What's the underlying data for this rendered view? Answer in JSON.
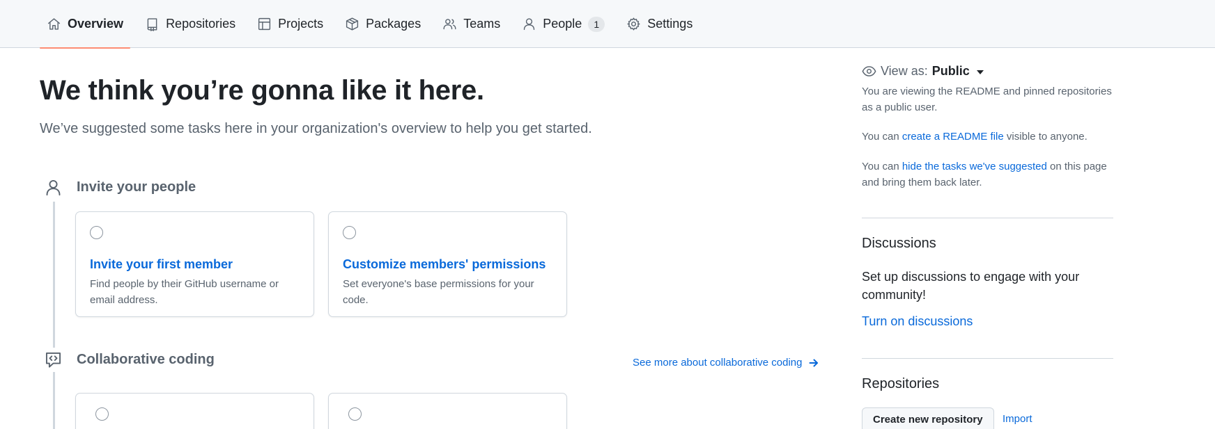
{
  "nav": {
    "tabs": [
      {
        "label": "Overview",
        "icon": "home-icon",
        "active": true
      },
      {
        "label": "Repositories",
        "icon": "repo-icon"
      },
      {
        "label": "Projects",
        "icon": "table-icon"
      },
      {
        "label": "Packages",
        "icon": "package-icon"
      },
      {
        "label": "Teams",
        "icon": "people-icon"
      },
      {
        "label": "People",
        "icon": "person-icon",
        "count": "1"
      },
      {
        "label": "Settings",
        "icon": "gear-icon"
      }
    ],
    "accent": "#fd8c73"
  },
  "hero": {
    "title": "We think you’re gonna like it here.",
    "subtitle": "We’ve suggested some tasks here in your organization's overview to help you get started."
  },
  "sections": [
    {
      "title": "Invite your people",
      "icon": "person-icon",
      "cards": [
        {
          "title": "Invite your first member",
          "description": "Find people by their GitHub username or email address."
        },
        {
          "title": "Customize members' permissions",
          "description": "Set everyone's base permissions for your code."
        }
      ]
    },
    {
      "title": "Collaborative coding",
      "icon": "code-review-icon",
      "link": "See more about collaborative coding"
    }
  ],
  "sidebar": {
    "view_as_label": "View as:",
    "view_as_value": "Public",
    "viewing_note": "You are viewing the README and pinned repositories as a public user.",
    "readme_prefix": "You can",
    "readme_link": "create a README file",
    "readme_suffix": "visible to anyone.",
    "hide_prefix": "You can",
    "hide_link": "hide the tasks we've suggested",
    "hide_suffix": "on this page and bring them back later.",
    "discussions": {
      "heading": "Discussions",
      "text": "Set up discussions to engage with your community!",
      "link": "Turn on discussions"
    },
    "repositories": {
      "heading": "Repositories",
      "create_button": "Create new repository",
      "import_link": "Import"
    }
  },
  "colors": {
    "link": "#0969da",
    "muted": "#59636e",
    "border": "#d0d7de"
  }
}
